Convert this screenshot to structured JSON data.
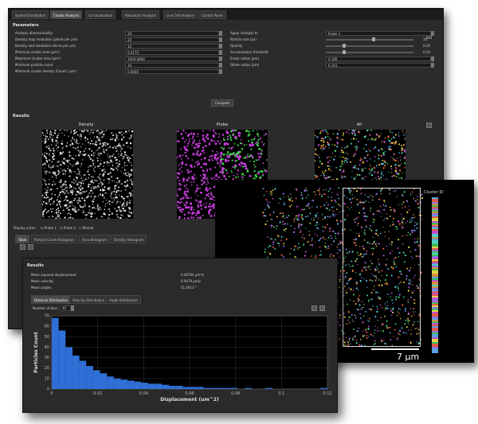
{
  "main_window": {
    "tabs": [
      "Spatial Distribution",
      "Cluster Analysis",
      "Co-Localization",
      "Resolution Analysis",
      "Live Cell Analysis",
      "Control Panel"
    ],
    "active_tab": 1,
    "parameters_title": "Parameters",
    "params_left": [
      {
        "label": "Analysis dimensionality",
        "value": "2D"
      },
      {
        "label": "Density map resolution (pixels per μm)",
        "value": "20"
      },
      {
        "label": "Density and resolution (slices per μm)",
        "value": "10"
      },
      {
        "label": "Minimum cluster area (μm²)",
        "value": "0.0175"
      },
      {
        "label": "Maximum cluster area (μm²)",
        "value": "1000.0000"
      },
      {
        "label": "Minimum particle count",
        "value": "10"
      },
      {
        "label": "Minimum cluster density (Count / μm²)",
        "value": "0.0000"
      }
    ],
    "params_right": [
      {
        "label": "Apply changes to",
        "value": "Probe 1",
        "kind": "select"
      },
      {
        "label": "Particle size (px)",
        "value": "10",
        "kind": "slider",
        "level": 0.55
      },
      {
        "label": "Opacity",
        "value": "0.20",
        "kind": "slider",
        "level": 0.2
      },
      {
        "label": "Accumulation threshold",
        "value": "0.20",
        "kind": "slider",
        "level": 0.2
      },
      {
        "label": "Erode radius (μm)",
        "value": "0.100",
        "kind": "field"
      },
      {
        "label": "Dilate radius (μm)",
        "value": "0.101",
        "kind": "field"
      }
    ],
    "compute_label": "Compute",
    "results_title": "Results",
    "image_titles": [
      "Density",
      "Probe",
      "All"
    ],
    "display_on_label": "Display on/as:",
    "checkboxes": [
      "Probe 1",
      "Probe 2",
      "Mutual"
    ],
    "result_tabs": [
      "Table",
      "Particle Count Histogram",
      "Area Histogram",
      "Density Histogram"
    ]
  },
  "image_window": {
    "scale_label": "7 μm",
    "colorbar_label": "Cluster ID"
  },
  "results_window": {
    "title": "Results",
    "stats": [
      {
        "label": "Mean squared displacement",
        "value": "0.40794 μm²/s"
      },
      {
        "label": "Mean velocity",
        "value": "0.9479 μm/s"
      },
      {
        "label": "Mean angles",
        "value": "51.0013 °"
      }
    ],
    "tabs": [
      "Distance Distribution",
      "Velocity Distribution",
      "Angle Distribution"
    ],
    "bins_label": "Number of bins:",
    "bins_value": "40"
  },
  "chart_data": {
    "type": "bar",
    "xlabel": "Displacement (um^2)",
    "ylabel": "Particles Count",
    "ylim": [
      0,
      70
    ],
    "xlim": [
      0,
      0.12
    ],
    "yticks": [
      0,
      10,
      20,
      30,
      40,
      50,
      60,
      70
    ],
    "xticks": [
      0,
      0.02,
      0.04,
      0.06,
      0.08,
      0.1,
      0.12
    ],
    "xtick_labels": [
      "0",
      "0.02",
      "0.04",
      "0.06",
      "0.08",
      "0.1",
      "0.12"
    ],
    "bar_color": "#2f6fd6",
    "bin_width": 0.003,
    "values": [
      68,
      56,
      40,
      32,
      27,
      22,
      18,
      15,
      12,
      10,
      9,
      8,
      7,
      6,
      5,
      5,
      4,
      3,
      3,
      2,
      2,
      2,
      1,
      1,
      1,
      1,
      1,
      0,
      1,
      0,
      0,
      1,
      0,
      0,
      0,
      0,
      0,
      0,
      0,
      1
    ]
  }
}
